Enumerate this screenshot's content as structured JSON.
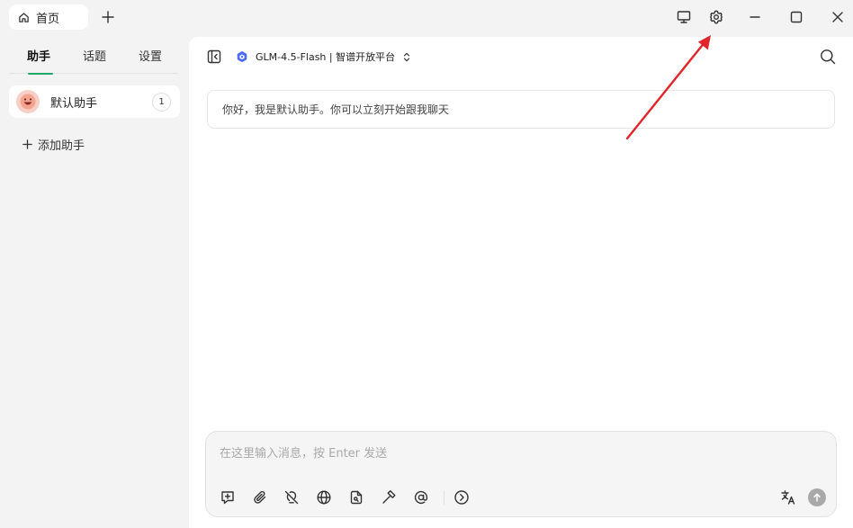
{
  "titlebar": {
    "home_tab_label": "首页",
    "icons": [
      "home-icon",
      "plus-icon",
      "monitor-icon",
      "gear-icon",
      "minimize-icon",
      "maximize-icon",
      "close-icon"
    ]
  },
  "sidebar": {
    "tabs": [
      {
        "label": "助手",
        "active": true
      },
      {
        "label": "话题",
        "active": false
      },
      {
        "label": "设置",
        "active": false
      }
    ],
    "assistant": {
      "name": "默认助手",
      "count": "1"
    },
    "add_label": "添加助手"
  },
  "main": {
    "model_label": "GLM-4.5-Flash | 智谱开放平台",
    "welcome_text": "你好，我是默认助手。你可以立刻开始跟我聊天",
    "composer_placeholder": "在这里输入消息，按 Enter 发送"
  },
  "colors": {
    "accent": "#1fa865",
    "annotation": "#e0262b",
    "model_logo": "#4b6bf5"
  }
}
